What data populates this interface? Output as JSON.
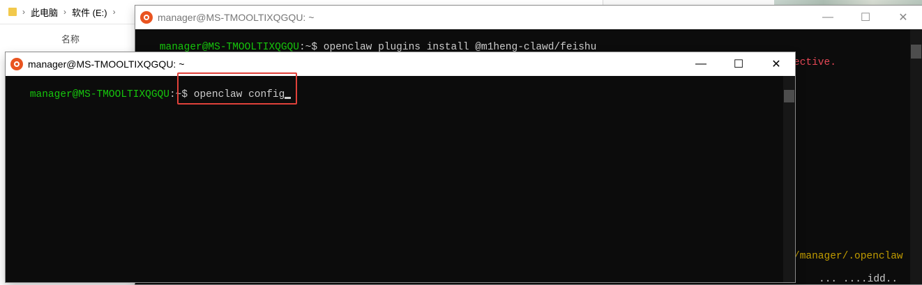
{
  "explorer": {
    "breadcrumb": [
      "此电脑",
      "软件 (E:)"
    ],
    "column_header": "名称"
  },
  "back_terminal": {
    "title": "manager@MS-TMOOLTIXQGQU: ~",
    "prompt_user": "manager@MS-TMOOLTIXQGQU",
    "prompt_sep": ":~",
    "prompt_dollar": "$",
    "command": "openclaw plugins install @m1heng-clawd/feishu",
    "output_fragment_1": "ective.",
    "output_fragment_2": "/manager/.openclaw",
    "output_fragment_3": "... ....idd.."
  },
  "front_terminal": {
    "title": "manager@MS-TMOOLTIXQGQU: ~",
    "prompt_user": "manager@MS-TMOOLTIXQGQU",
    "prompt_sep": ":~",
    "prompt_dollar": "$",
    "command": "openclaw config"
  },
  "window_controls": {
    "minimize": "—",
    "maximize": "☐",
    "close": "✕"
  },
  "colors": {
    "terminal_bg": "#0c0c0c",
    "prompt_green": "#16c60c",
    "highlight_red": "#e0413a",
    "ubuntu_orange": "#e95420"
  }
}
